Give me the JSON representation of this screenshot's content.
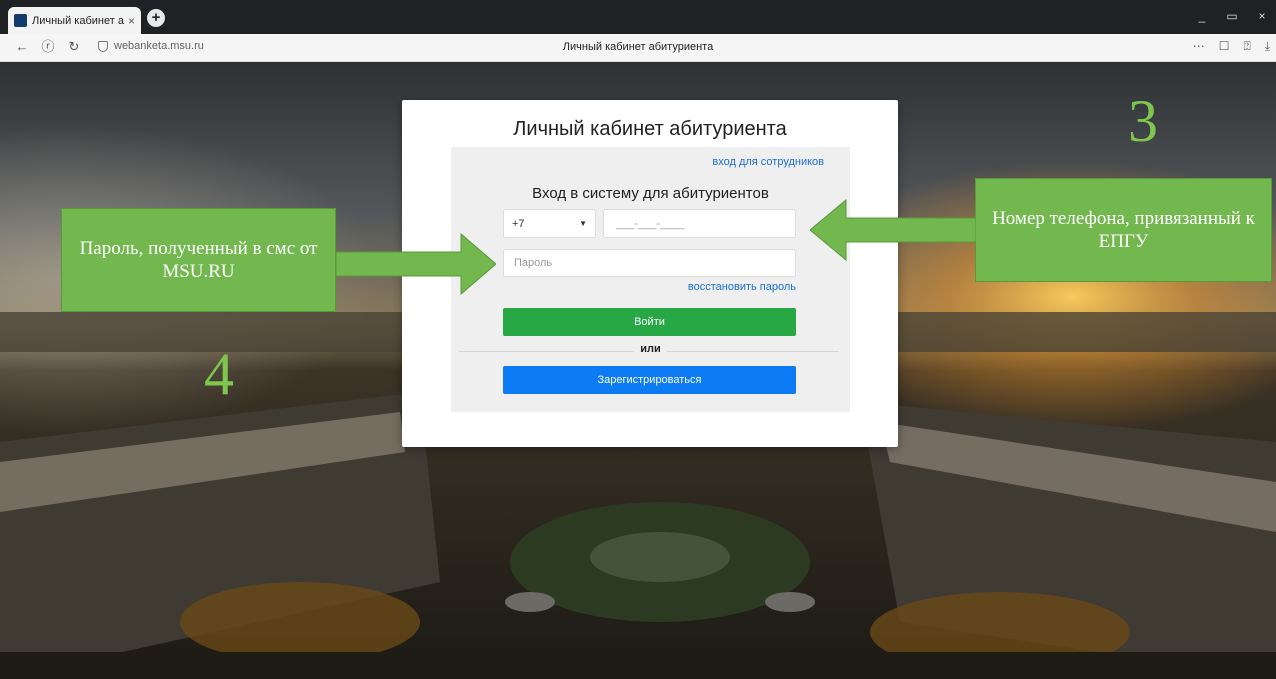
{
  "browser": {
    "tab_title": "Личный кабинет абиту",
    "tab_close": "×",
    "new_tab": "+",
    "url": "webanketa.msu.ru",
    "page_title": "Личный кабинет абитуриента",
    "controls": [
      "_",
      "▭",
      "×"
    ],
    "nav_right": [
      "⋯",
      "☐",
      "⍰",
      "⤓"
    ]
  },
  "card": {
    "title": "Личный кабинет абитуриента",
    "staff_link": "вход для сотрудников",
    "login_heading": "Вход в систему для абитуриентов",
    "country_code": "+7",
    "phone_placeholder": "___-___-____",
    "password_placeholder": "Пароль",
    "restore_link": "восстановить пароль",
    "login_button": "Войти",
    "or_text": "или",
    "register_button": "Зарегистрироваться"
  },
  "annotations": {
    "left_callout": "Пароль, полученный в смс от MSU.RU",
    "right_callout": "Номер телефона, привязанный к ЕПГУ",
    "step_right": "3",
    "step_left": "4",
    "accent_color": "#73b74f"
  }
}
